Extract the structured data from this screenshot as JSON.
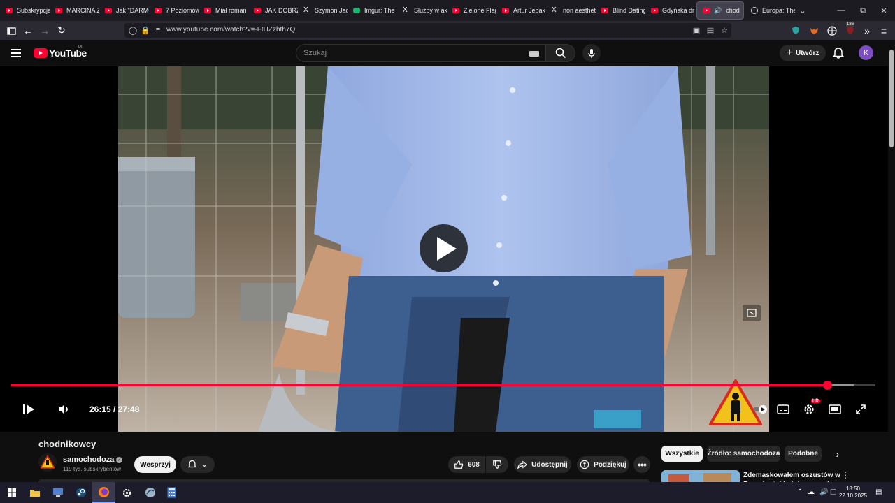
{
  "browser": {
    "tabs": [
      {
        "label": "Subskrypcje",
        "icon": "youtube-icon"
      },
      {
        "label": "MARCINA Z",
        "icon": "youtube-icon"
      },
      {
        "label": "Jak \"DARMO",
        "icon": "youtube-icon"
      },
      {
        "label": "7 Poziomów",
        "icon": "youtube-icon"
      },
      {
        "label": "Miał roman",
        "icon": "youtube-icon"
      },
      {
        "label": "JAK DOBRZ",
        "icon": "youtube-icon"
      },
      {
        "label": "Szymon Jad",
        "icon": "x-icon"
      },
      {
        "label": "Imgur: The",
        "icon": "imgur-icon"
      },
      {
        "label": "Służby w ak",
        "icon": "x-icon"
      },
      {
        "label": "Zielone Flag",
        "icon": "youtube-icon"
      },
      {
        "label": "Artur Jebak",
        "icon": "youtube-icon"
      },
      {
        "label": "non aesthet",
        "icon": "x-icon"
      },
      {
        "label": "Blind Dating",
        "icon": "youtube-icon"
      },
      {
        "label": "Gdyńska dr",
        "icon": "youtube-icon"
      },
      {
        "label": "chod",
        "icon": "youtube-icon",
        "active": true
      },
      {
        "label": "Europa: The",
        "icon": "globe-icon"
      }
    ],
    "url": "www.youtube.com/watch?v=-FtHZzhth7Q",
    "extension_badge": "186"
  },
  "youtube": {
    "logo_text": "YouTube",
    "region": "PL",
    "search_placeholder": "Szukaj",
    "create_label": "Utwórz",
    "avatar_letter": "K"
  },
  "player": {
    "time_display": "26:15 / 27:48",
    "progress_fraction": 0.9442,
    "buffered_fraction": 0.975,
    "hd_label": "HD"
  },
  "video": {
    "title": "chodnikowcy",
    "channel": "samochodoza",
    "subscribers": "119 tys. subskrybentów",
    "support_label": "Wesprzyj",
    "likes": "608",
    "share_label": "Udostępnij",
    "thanks_label": "Podziękuj"
  },
  "sidebar": {
    "chips": [
      "Wszystkie",
      "Źródło: samochodoza",
      "Podobne"
    ],
    "recommended_title": "Zdemaskowałem oszustów w Barcelonie! Łatakowanych"
  },
  "taskbar": {
    "time": "18:50",
    "date": "22.10.2025"
  }
}
